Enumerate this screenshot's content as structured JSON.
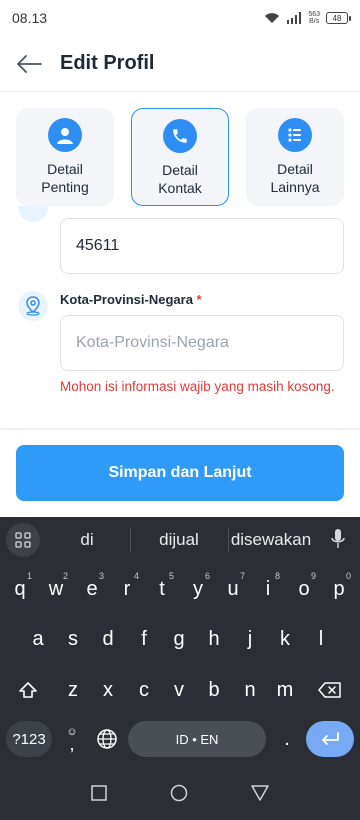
{
  "status_bar": {
    "time": "08.13",
    "net_speed_value": "563",
    "net_speed_unit": "B/s",
    "battery": "48"
  },
  "header": {
    "title": "Edit Profil"
  },
  "tabs": [
    {
      "label_line1": "Detail",
      "label_line2": "Penting",
      "icon": "user-icon",
      "active": false
    },
    {
      "label_line1": "Detail",
      "label_line2": "Kontak",
      "icon": "phone-icon",
      "active": true
    },
    {
      "label_line1": "Detail",
      "label_line2": "Lainnya",
      "icon": "list-icon",
      "active": false
    }
  ],
  "form": {
    "postal_code_value": "45611",
    "location_label": "Kota-Provinsi-Negara",
    "required_mark": "*",
    "location_placeholder": "Kota-Provinsi-Negara",
    "error_message": "Mohon isi informasi wajib yang masih kosong."
  },
  "primary_button": {
    "label": "Simpan dan Lanjut"
  },
  "keyboard": {
    "suggestions": [
      "di",
      "dijual",
      "disewakan"
    ],
    "row1": [
      {
        "key": "q",
        "hint": "1"
      },
      {
        "key": "w",
        "hint": "2"
      },
      {
        "key": "e",
        "hint": "3"
      },
      {
        "key": "r",
        "hint": "4"
      },
      {
        "key": "t",
        "hint": "5"
      },
      {
        "key": "y",
        "hint": "6"
      },
      {
        "key": "u",
        "hint": "7"
      },
      {
        "key": "i",
        "hint": "8"
      },
      {
        "key": "o",
        "hint": "9"
      },
      {
        "key": "p",
        "hint": "0"
      }
    ],
    "row2": [
      "a",
      "s",
      "d",
      "f",
      "g",
      "h",
      "j",
      "k",
      "l"
    ],
    "row3": [
      "z",
      "x",
      "c",
      "v",
      "b",
      "n",
      "m"
    ],
    "symbols_key": "?123",
    "comma_key": ",",
    "comma_hint": "☺",
    "space_label": "ID • EN",
    "period_key": "."
  },
  "colors": {
    "accent": "#2f8ef3",
    "button": "#2f9bf7",
    "error": "#e53935",
    "keyboard_bg": "#2b2f35",
    "enter_key": "#77a9f5"
  }
}
